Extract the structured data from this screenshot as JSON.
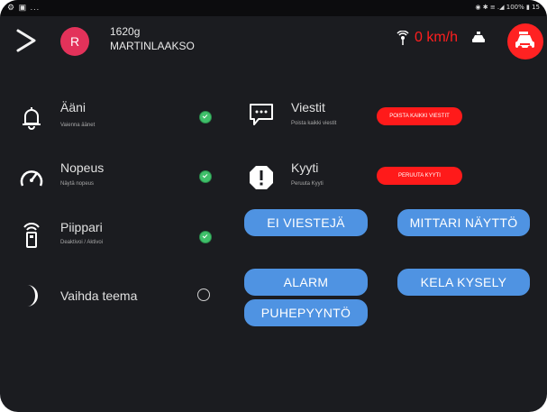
{
  "statusbar": {
    "left": "⚙ ▣ ...",
    "right": "◉ ✱ ≡ .◢ 100% ▮ 15"
  },
  "header": {
    "avatar_initial": "R",
    "vehicle_id": "1620g",
    "location": "MARTINLAAKSO",
    "speed": "0 km/h"
  },
  "settings": [
    {
      "title": "Ääni",
      "subtitle": "Vaienna äänet",
      "icon": "bell-icon",
      "enabled": true
    },
    {
      "title": "Nopeus",
      "subtitle": "Näytä nopeus",
      "icon": "speedometer-icon",
      "enabled": true
    },
    {
      "title": "Piippari",
      "subtitle": "Deaktivoi / Aktivoi",
      "icon": "pager-icon",
      "enabled": true
    },
    {
      "title": "Vaihda teema",
      "subtitle": "",
      "icon": "moon-icon",
      "enabled": false
    }
  ],
  "actions": [
    {
      "title": "Viestit",
      "subtitle": "Poista kaikki viestit",
      "icon": "message-icon",
      "button": "POISTA KAIKKI VIESTIT"
    },
    {
      "title": "Kyyti",
      "subtitle": "Peruuta Kyyti",
      "icon": "alert-icon",
      "button": "PERUUTA KYYTI"
    }
  ],
  "buttons": {
    "no_messages": "EI VIESTEJÄ",
    "meter_display": "MITTARI NÄYTTÖ",
    "alarm": "ALARM",
    "kela_query": "KELA KYSELY",
    "call_request": "PUHEPYYNTÖ"
  },
  "colors": {
    "background": "#1b1c20",
    "accent_red": "#ff1a1a",
    "button_blue": "#4f93e2",
    "avatar": "#e3325a",
    "toggle_on": "#3fc06a"
  }
}
